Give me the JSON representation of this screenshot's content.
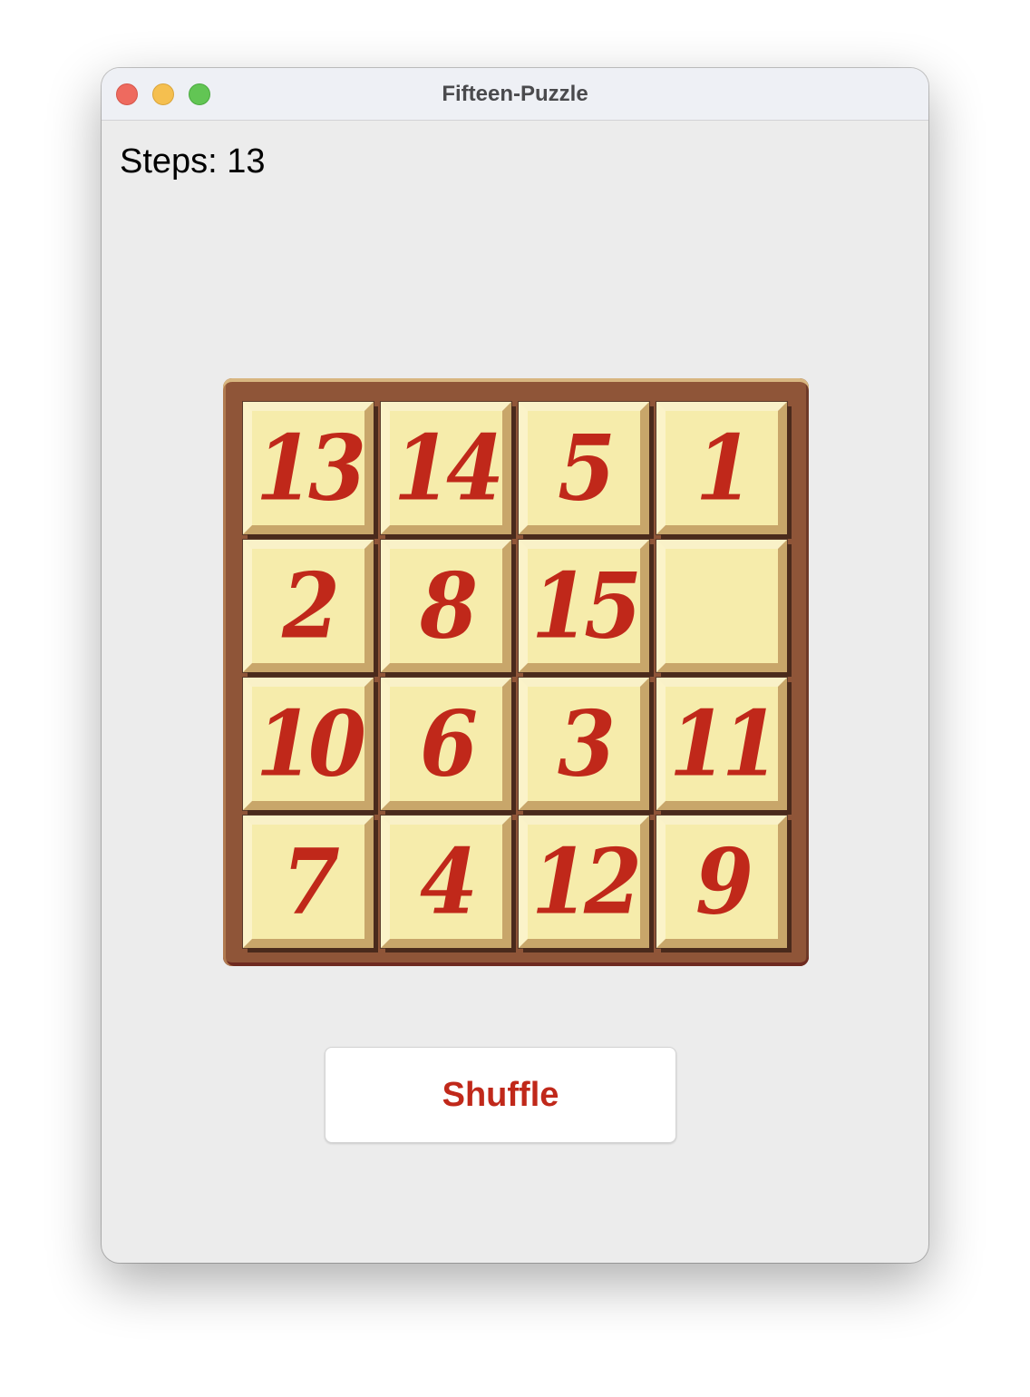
{
  "window": {
    "title": "Fifteen-Puzzle"
  },
  "steps": {
    "label": "Steps:",
    "value": "13"
  },
  "board": {
    "rows": 4,
    "cols": 4,
    "tiles": [
      "13",
      "14",
      "5",
      "1",
      "2",
      "8",
      "15",
      "",
      "10",
      "6",
      "3",
      "11",
      "7",
      "4",
      "12",
      "9"
    ]
  },
  "actions": {
    "shuffle_label": "Shuffle"
  },
  "colors": {
    "tile_text": "#c0281a",
    "tile_face": "#f6ecab",
    "board": "#8f5538",
    "button_text": "#c0281a"
  }
}
